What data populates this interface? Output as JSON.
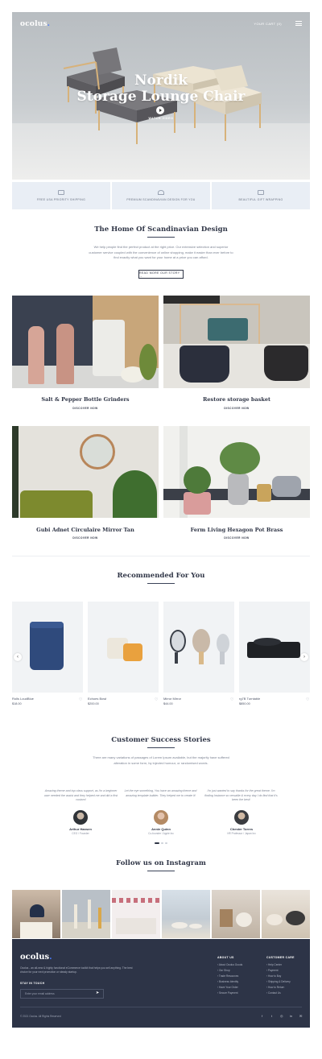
{
  "header": {
    "logo": "ocolus",
    "logo_dot": ".",
    "cart": "YOUR CART (0)",
    "menu_icon": "hamburger-icon"
  },
  "hero": {
    "title_line1": "Nordik",
    "title_line2": "Storage Lounge Chair",
    "video_label": "WATCH VIDEO"
  },
  "features": [
    {
      "icon": "truck-icon",
      "label": "FREE USA PRIORITY SHIPPING"
    },
    {
      "icon": "diamond-icon",
      "label": "PREMIUM SCANDINAVIAN DESIGN FOR YOU"
    },
    {
      "icon": "gift-icon",
      "label": "BEAUTIFUL GIFT WRAPPING"
    }
  ],
  "intro": {
    "title": "The Home Of Scandinavian Design",
    "text": "We help people find the perfect product at the right price. Our extensive selection and superior customer service coupled with the convenience of online shopping, make it easier than ever before to find exactly what you want for your home at a price you can afford.",
    "button": "READ MORE OUR STORY →"
  },
  "categories": [
    {
      "name": "Salt & Pepper Bottle Grinders",
      "link": "DISCOVER NOW"
    },
    {
      "name": "Restore storage basket",
      "link": "DISCOVER NOW"
    },
    {
      "name": "Gubi Adnet Circulaire Mirror Tan",
      "link": "DISCOVER NOW"
    },
    {
      "name": "Ferm Living Hexagon Pot Brass",
      "link": "DISCOVER NOW"
    }
  ],
  "recommended": {
    "title": "Recommended For You",
    "products": [
      {
        "name": "Rolls LoudBlue",
        "price": "$18.00"
      },
      {
        "name": "Echoes Bowl",
        "price": "$200.00"
      },
      {
        "name": "Mirror Mirror",
        "price": "$44.00"
      },
      {
        "name": "rg7B Turntable",
        "price": "$850.00"
      }
    ]
  },
  "testimonials": {
    "title": "Customer Success Stories",
    "text": "There are many variations of passages of Lorem Ipsum available, but the majority have suffered alteration in some form, by injected humour, or randomised words.",
    "items": [
      {
        "quote": "Amazing theme and top class support, as I'm a beginner user needed the assist and they helped me and did a first custom!",
        "name": "Arthur Hansen",
        "role": "CEO / Founder"
      },
      {
        "quote": "Let the eye something, You have an amazing theme and amazing template builder. They helped me to create it!",
        "name": "Annie Quinn",
        "role": "Co-founder / Apple Inc"
      },
      {
        "quote": "I'm just wanted to say thanks for the great theme. I'm finding Instance so versatile & every day I do find that it's been the best!",
        "name": "Chester Torres",
        "role": "HR Professor / Japan Inc"
      }
    ]
  },
  "instagram": {
    "title": "Follow us on Instagram"
  },
  "footer": {
    "logo": "ocolus",
    "logo_dot": ".",
    "about": "Ocolus - an all-new & highly functional eCommerce toolkit that helps you sell anything. The best choice for your next promotion or steady startup.",
    "stay": "STAY IN TOUCH",
    "email_placeholder": "Enter your email address",
    "col1_title": "ABOUT US",
    "col1": [
      "About Ocolus Goods",
      "Our Shop",
      "Trade Resources",
      "Business Identity",
      "Have Your Order",
      "Secure Payment"
    ],
    "col2_title": "CUSTOMER CARE",
    "col2": [
      "Help Center",
      "Payment",
      "How to Buy",
      "Shipping & Delivery",
      "How to Return",
      "Contact Us"
    ],
    "copyright": "© 2021 Ocolus. All Rights Reserved",
    "social": [
      "f",
      "t",
      "◎",
      "in",
      "✉"
    ]
  },
  "colors": {
    "accent": "#2d3447",
    "brand_dot": "#4a7cff",
    "feature_bg": "#e9eef5"
  }
}
